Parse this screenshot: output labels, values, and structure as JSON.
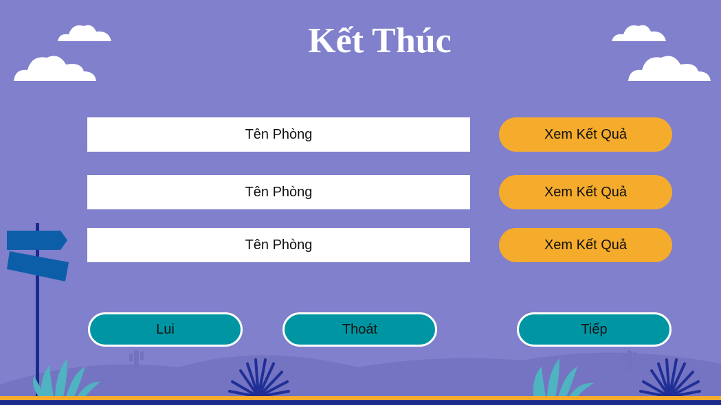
{
  "title": "Kết Thúc",
  "rooms": [
    {
      "name": "Tên Phòng",
      "action_label": "Xem Kết Quả"
    },
    {
      "name": "Tên Phòng",
      "action_label": "Xem Kết Quả"
    },
    {
      "name": "Tên Phòng",
      "action_label": "Xem Kết Quả"
    }
  ],
  "nav": {
    "back_label": "Lui",
    "exit_label": "Thoát",
    "next_label": "Tiếp"
  },
  "colors": {
    "background": "#8080cc",
    "result_button": "#f5ab2c",
    "nav_button": "#0095a3",
    "ground": "#f5ab2c",
    "ground_base": "#1a2b8c"
  }
}
